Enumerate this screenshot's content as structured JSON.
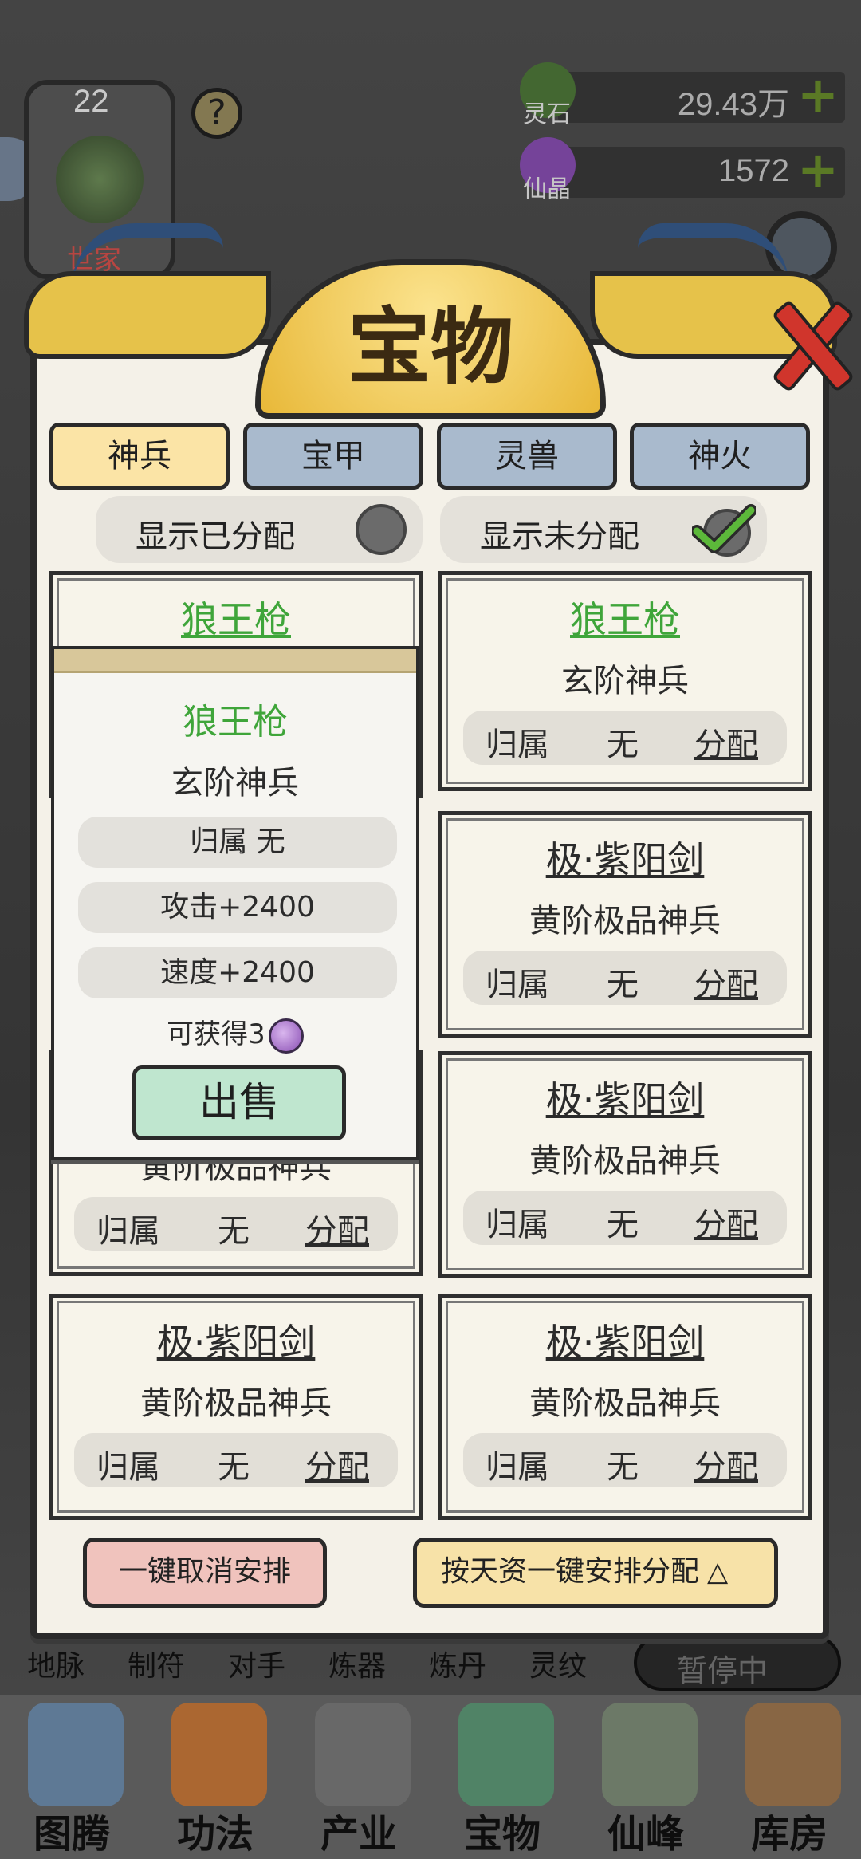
{
  "header": {
    "level": "22",
    "family_label": "世家",
    "resources": [
      {
        "name": "灵石",
        "value": "29.43万",
        "icon": "leaf-stone-icon",
        "color": "#4f7a3a"
      },
      {
        "name": "仙晶",
        "value": "1572",
        "icon": "purple-crystal-icon",
        "color": "#8a4fb4"
      }
    ]
  },
  "dialog": {
    "title": "宝物",
    "tabs": [
      {
        "label": "神兵",
        "active": true
      },
      {
        "label": "宝甲",
        "active": false
      },
      {
        "label": "灵兽",
        "active": false
      },
      {
        "label": "神火",
        "active": false
      }
    ],
    "filters": {
      "show_assigned": {
        "label": "显示已分配",
        "checked": false
      },
      "show_unassigned": {
        "label": "显示未分配",
        "checked": true
      }
    },
    "cards": [
      {
        "name": "狼王枪",
        "tier": "玄阶神兵",
        "owner_label": "归属",
        "owner": "无",
        "assign_label": "分配",
        "green": true
      },
      {
        "name": "狼王枪",
        "tier": "玄阶神兵",
        "owner_label": "归属",
        "owner": "无",
        "assign_label": "分配",
        "green": true
      },
      {
        "name": "极·紫阳剑",
        "tier": "黄阶极品神兵",
        "owner_label": "归属",
        "owner": "无",
        "assign_label": "分配",
        "green": false
      },
      {
        "name": "极·紫阳剑",
        "tier": "黄阶极品神兵",
        "owner_label": "归属",
        "owner": "无",
        "assign_label": "分配",
        "green": false
      },
      {
        "name": "极·紫阳剑",
        "tier": "黄阶极品神兵",
        "owner_label": "归属",
        "owner": "无",
        "assign_label": "分配",
        "green": false
      },
      {
        "name": "极·紫阳剑",
        "tier": "黄阶极品神兵",
        "owner_label": "归属",
        "owner": "无",
        "assign_label": "分配",
        "green": false
      },
      {
        "name": "极·紫阳剑",
        "tier": "黄阶极品神兵",
        "owner_label": "归属",
        "owner": "无",
        "assign_label": "分配",
        "green": false
      }
    ],
    "popup": {
      "name": "狼王枪",
      "tier": "玄阶神兵",
      "owner": "归属 无",
      "attack": "攻击+2400",
      "speed": "速度+2400",
      "gain": "可获得3",
      "sell_label": "出售"
    },
    "footer": {
      "cancel_label": "一键取消安排",
      "assign_label": "按天资一键安排分配"
    }
  },
  "subnav": [
    "地脉",
    "制符",
    "对手",
    "炼器",
    "炼丹",
    "灵纹"
  ],
  "paused_label": "暂停中",
  "bottom_nav": [
    "图腾",
    "功法",
    "产业",
    "宝物",
    "仙峰",
    "库房"
  ],
  "colors": {
    "accent_green": "#3fa53a",
    "tab_active": "#fbe4a6",
    "tab_inactive": "#a9bacd",
    "close_red": "#d0352c"
  }
}
